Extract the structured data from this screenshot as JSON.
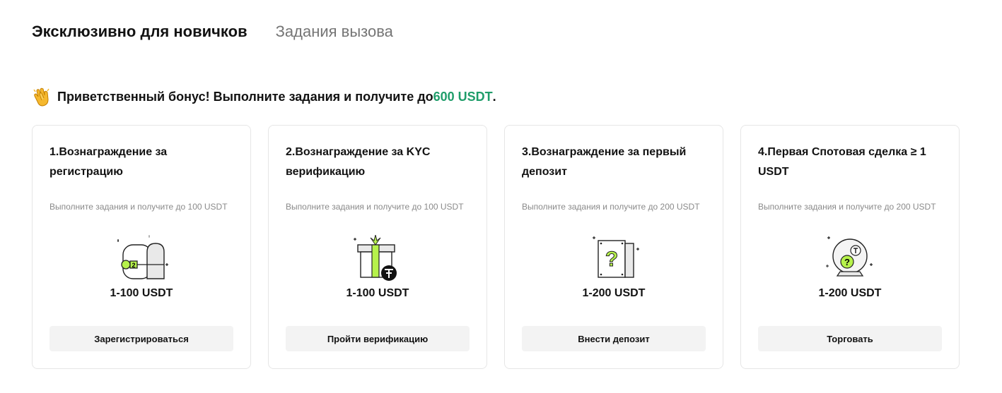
{
  "tabs": [
    {
      "label": "Эксклюзивно для новичков",
      "active": true
    },
    {
      "label": "Задания вызова",
      "active": false
    }
  ],
  "banner": {
    "icon": "clapping-hands-icon",
    "text_before": "Приветственный бонус! Выполните задания и получите до ",
    "amount": "600 USDT",
    "text_after": ".",
    "accent_color": "#1f9d6a"
  },
  "cards": [
    {
      "title": "1.Вознаграждение за регистрацию",
      "subtitle": "Выполните задания и получите до 100 USDT",
      "icon": "treasure-key-icon",
      "range": "1-100 USDT",
      "button": "Зарегистрироваться"
    },
    {
      "title": "2.Вознаграждение за KYC верификацию",
      "subtitle": "Выполните задания и получите до 100 USDT",
      "icon": "gift-box-icon",
      "range": "1-100 USDT",
      "button": "Пройти верификацию"
    },
    {
      "title": "3.Вознаграждение за первый депозит",
      "subtitle": "Выполните задания и получите до 200 USDT",
      "icon": "mystery-box-icon",
      "range": "1-200 USDT",
      "button": "Внести депозит"
    },
    {
      "title": "4.Первая Спотовая сделка ≥ 1 USDT",
      "subtitle": "Выполните задания и получите до 200 USDT",
      "icon": "crystal-ball-icon",
      "range": "1-200 USDT",
      "button": "Торговать"
    }
  ]
}
